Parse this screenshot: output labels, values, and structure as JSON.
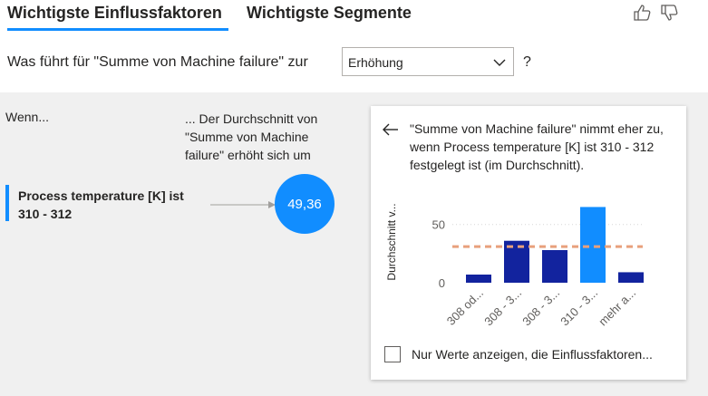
{
  "tabs": {
    "active_label": "Wichtigste Einflussfaktoren",
    "inactive_label": "Wichtigste Segmente"
  },
  "question": {
    "prefix": "Was führt für \"Summe von Machine failure\" zur",
    "dropdown_value": "Erhöhung",
    "suffix": "?"
  },
  "columns": {
    "left_header": "Wenn...",
    "right_header": "... Der Durchschnitt von \"Summe von Machine failure\" erhöht sich um"
  },
  "influencer": {
    "label": "Process temperature [K] ist 310 - 312",
    "value": "49,36"
  },
  "detail": {
    "description": "\"Summe von Machine failure\" nimmt eher zu, wenn Process temperature [K] ist 310 - 312 festgelegt ist (im Durchschnitt).",
    "checkbox_label": "Nur Werte anzeigen, die Einflussfaktoren..."
  },
  "colors": {
    "accent": "#118dff",
    "bar_dark": "#12239e",
    "average_line": "#e8a07c"
  },
  "chart_data": {
    "type": "bar",
    "ylabel": "Durchschnitt v...",
    "categories": [
      "308 od...",
      "308 - 3...",
      "308 - 3...",
      "310 - 3...",
      "mehr a..."
    ],
    "values": [
      7,
      36,
      28,
      65,
      9
    ],
    "highlighted_index": 3,
    "average": 31,
    "yticks": [
      "0",
      "50"
    ],
    "ylim": [
      0,
      70
    ],
    "grid": true
  }
}
